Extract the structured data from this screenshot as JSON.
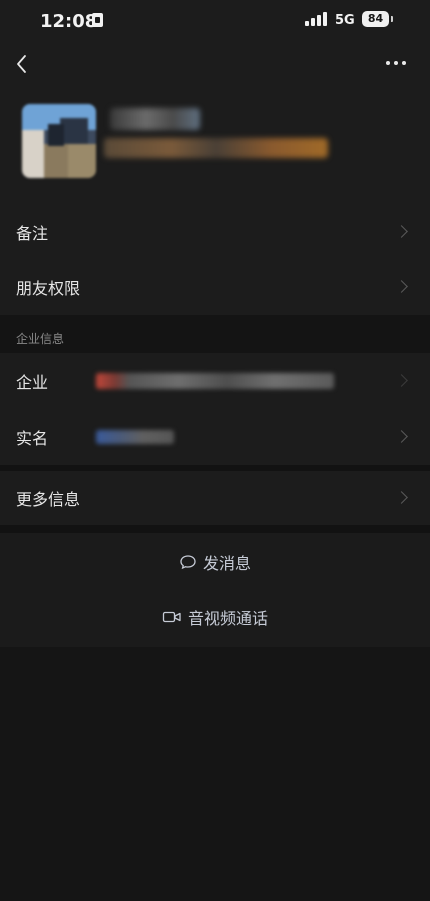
{
  "status_bar": {
    "time": "12:08",
    "network": "5G",
    "battery": "84"
  },
  "icons": {
    "back": "chevron-left-icon",
    "more": "more-dots-icon",
    "chevron": "chevron-right-icon",
    "message": "chat-bubble-icon",
    "video": "video-camera-icon"
  },
  "list": {
    "remark_label": "备注",
    "permissions_label": "朋友权限"
  },
  "enterprise": {
    "section_title": "企业信息",
    "company_label": "企业",
    "real_name_label": "实名"
  },
  "more": {
    "more_info_label": "更多信息"
  },
  "actions": {
    "message_label": "发消息",
    "call_label": "音视频通话"
  },
  "colors": {
    "background": "#161616",
    "row_background": "#1c1c1c",
    "text": "#e6e6e6",
    "action_text": "#c6cbd6"
  }
}
